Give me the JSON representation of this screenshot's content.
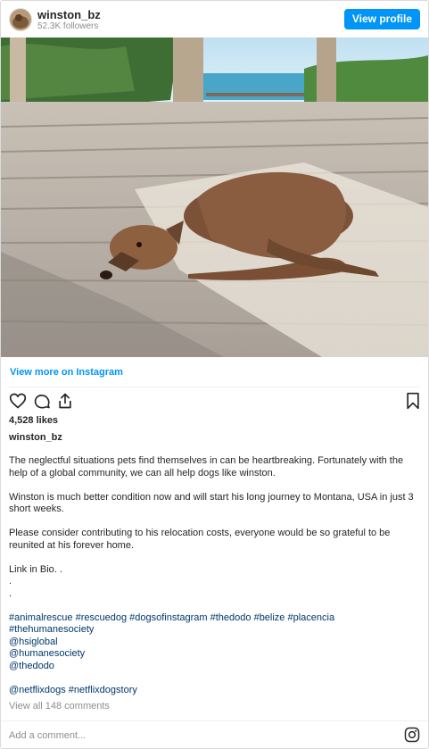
{
  "header": {
    "username": "winston_bz",
    "followers": "52.3K followers",
    "view_profile": "View profile"
  },
  "post": {
    "view_more": "View more on Instagram",
    "likes": "4,528 likes",
    "caption_user": "winston_bz",
    "caption": {
      "p1": "The neglectful situations pets find themselves in can be heartbreaking. Fortunately with the help of a global community, we can all help dogs like winston.",
      "p2": "Winston is much better condition now and will start his long journey to Montana, USA in just 3 short weeks.",
      "p3": "Please consider contributing to his relocation costs, everyone would be so grateful to be reunited at his forever home.",
      "p4": "Link in Bio. .",
      "dot1": ".",
      "dot2": ".",
      "tags1": "#animalrescue #rescuedog #dogsofinstagram #thedodo #belize #placencia",
      "tags2": "#thehumanesociety",
      "mention1": "@hsiglobal",
      "mention2": "@humanesociety",
      "mention3": "@thedodo",
      "tags3": "@netflixdogs #netflixdogstory"
    },
    "view_comments": "View all 148 comments",
    "add_comment": "Add a comment..."
  },
  "icons": {
    "like": "heart-icon",
    "comment": "comment-icon",
    "share": "share-icon",
    "save": "bookmark-icon",
    "brand": "instagram-icon"
  },
  "colors": {
    "accent": "#0095f6",
    "hashtag": "#00376b",
    "muted": "#8e8e8e"
  }
}
